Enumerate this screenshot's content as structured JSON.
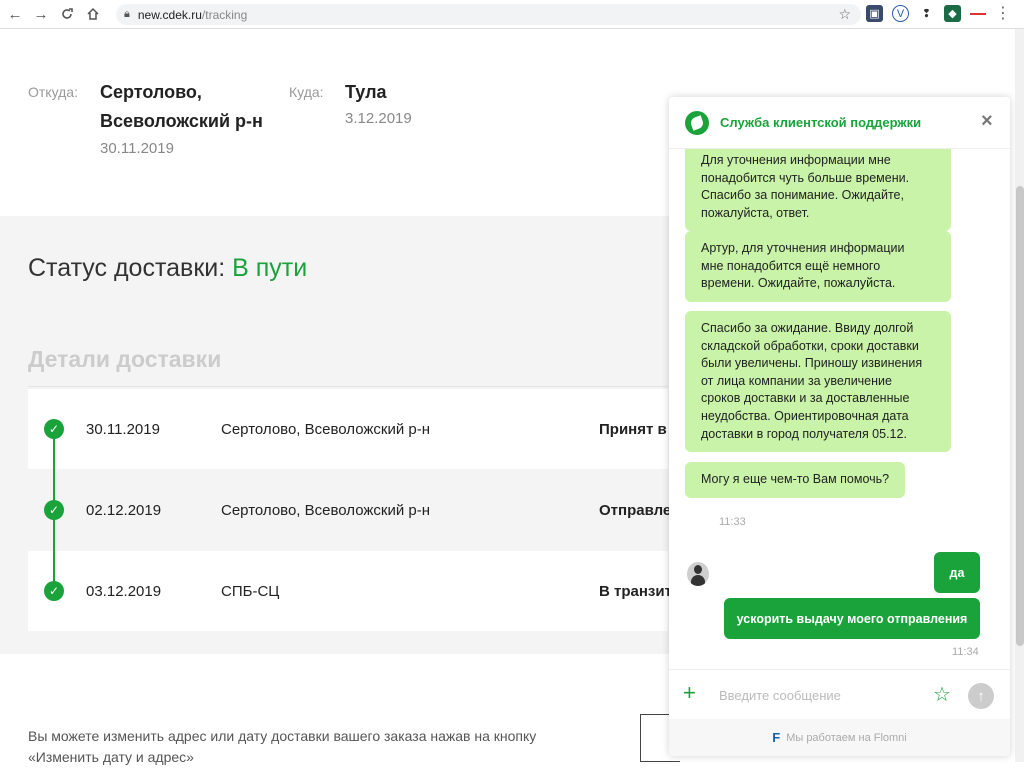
{
  "browser": {
    "url_host": "new.cdek.ru",
    "url_path": "/tracking",
    "nav": {
      "back": "←",
      "forward": "→",
      "reload": "C",
      "home": "⌂"
    }
  },
  "route": {
    "from_label": "Откуда:",
    "from_city_line1": "Сертолово,",
    "from_city_line2": "Всеволожский р-н",
    "from_date": "30.11.2019",
    "to_label": "Куда:",
    "to_city": "Тула",
    "to_date": "3.12.2019"
  },
  "status": {
    "label": "Статус доставки:",
    "value": "В пути"
  },
  "details": {
    "title": "Детали доставки",
    "rows": [
      {
        "date": "30.11.2019",
        "place": "Сертолово, Всеволожский р-н",
        "state": "Принят в"
      },
      {
        "date": "02.12.2019",
        "place": "Сертолово, Всеволожский р-н",
        "state": "Отправле"
      },
      {
        "date": "03.12.2019",
        "place": "СПБ-СЦ",
        "state": "В транзит"
      }
    ]
  },
  "footer": {
    "note_line1": "Вы можете изменить адрес или дату доставки вашего заказа нажав на кнопку",
    "note_line2": "«Изменить дату и адрес»"
  },
  "chat": {
    "title": "Служба клиентской поддержки",
    "close": "×",
    "messages_in": [
      {
        "lines": [
          "Для уточнения информации мне",
          "понадобится чуть больше времени.",
          "Спасибо за понимание. Ожидайте,",
          "пожалуйста, ответ."
        ]
      },
      {
        "lines": [
          "Артур, для уточнения информации",
          "мне понадобится ещё немного",
          "времени. Ожидайте, пожалуйста."
        ]
      },
      {
        "lines": [
          "Спасибо за ожидание. Ввиду долгой",
          "складской обработки, сроки доставки",
          "были увеличены. Приношу извинения",
          "от лица компании за увеличение",
          "сроков доставки и за доставленные",
          "неудобства. Ориентировочная дата",
          "доставки в город получателя 05.12."
        ]
      },
      {
        "lines": [
          "Могу я еще чем-то Вам помочь?"
        ]
      }
    ],
    "agent_time": "11:33",
    "messages_out": [
      "да",
      "ускорить выдачу моего отправления"
    ],
    "user_time": "11:34",
    "input_placeholder": "Введите сообщение",
    "powered_by": "Мы работаем на Flomni",
    "powered_logo": "F"
  },
  "colors": {
    "brand_green": "#1aa33b",
    "bubble_in": "#c9f3a8"
  }
}
